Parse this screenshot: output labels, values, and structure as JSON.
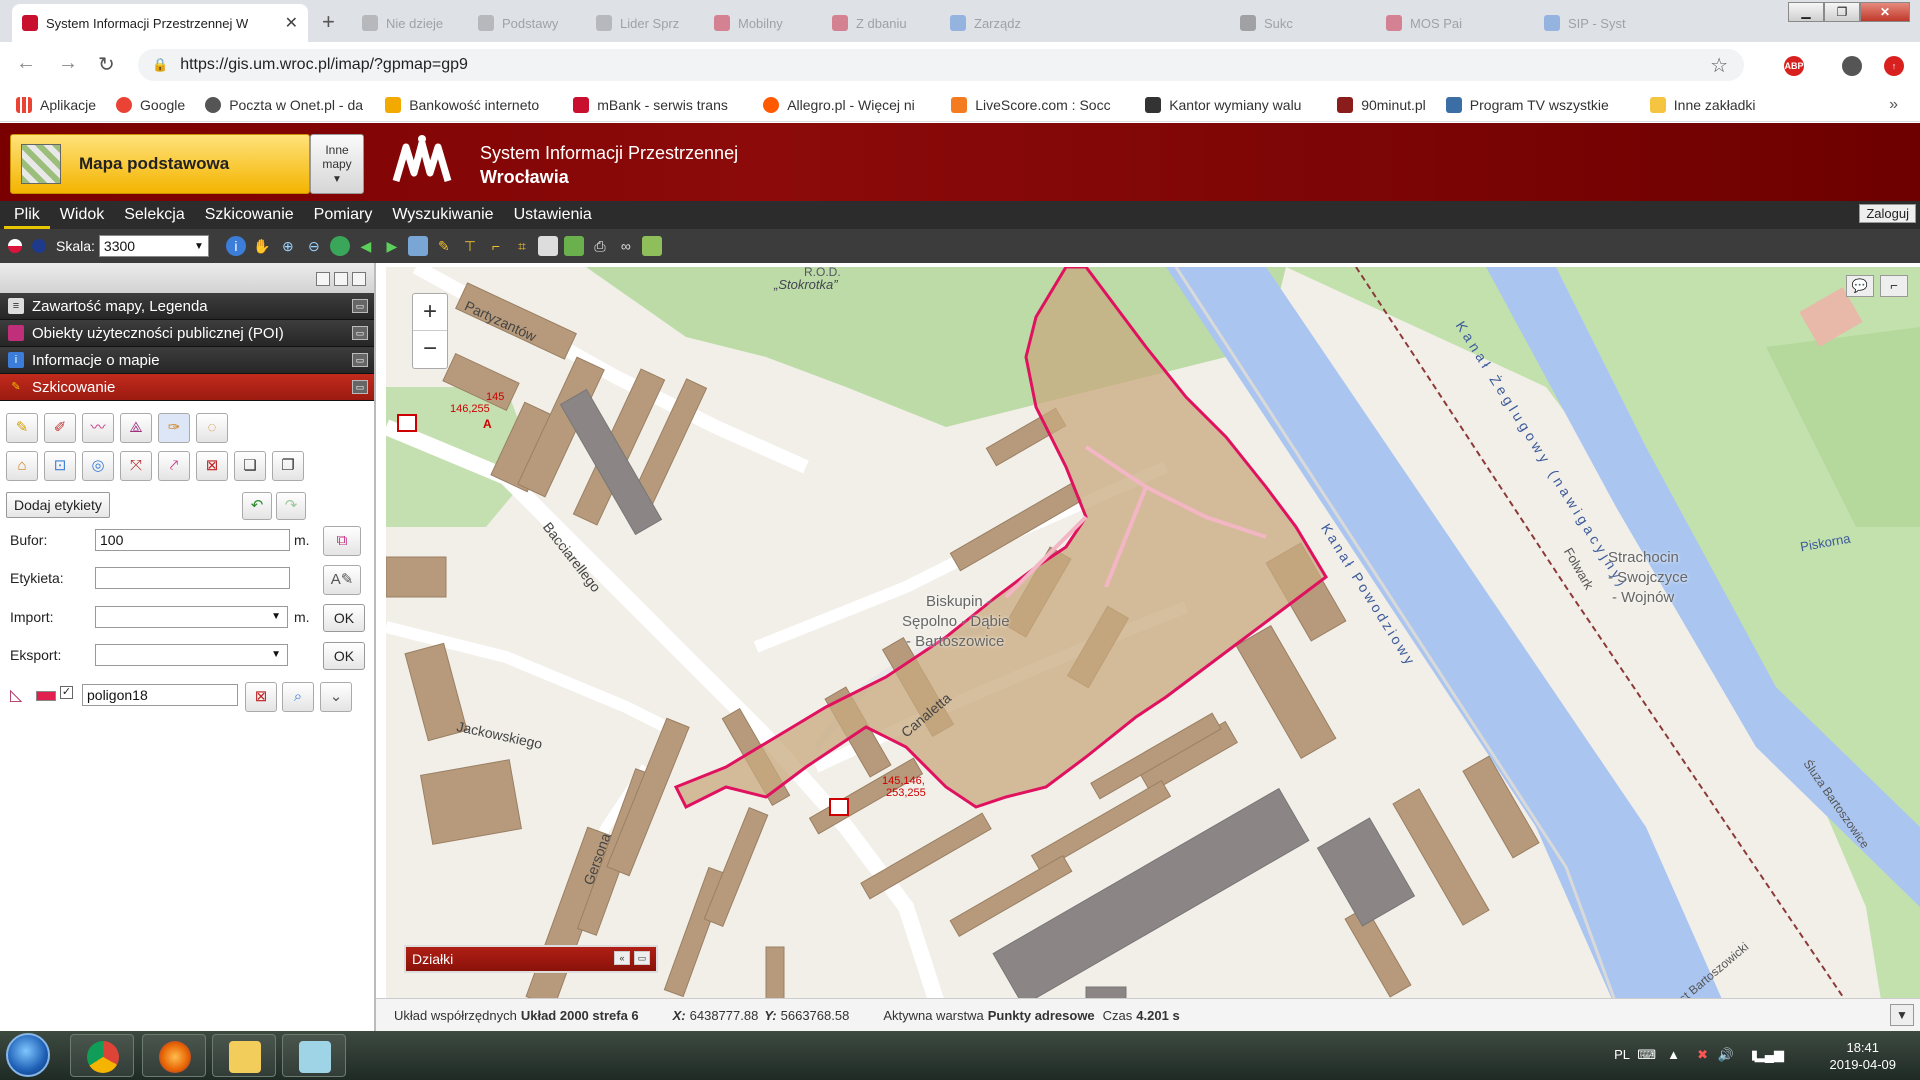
{
  "browser": {
    "tabs": [
      {
        "title": "System Informacji Przestrzennej W",
        "active": true
      },
      {
        "title": "Nie dzieje",
        "active": false
      },
      {
        "title": "Podstawy",
        "active": false
      },
      {
        "title": "Lider Sprz",
        "active": false
      },
      {
        "title": "Mobilny",
        "active": false
      },
      {
        "title": "Z dbaniu",
        "active": false
      },
      {
        "title": "Zarządz",
        "active": false
      },
      {
        "title": "Sukc",
        "active": false
      },
      {
        "title": "MOS Pai",
        "active": false
      },
      {
        "title": "SIP - Syst",
        "active": false
      }
    ],
    "close_glyph": "✕",
    "new_tab_glyph": "+",
    "url": "https://gis.um.wroc.pl/imap/?gpmap=gp9",
    "abp_label": "ABP",
    "bookmarks": [
      {
        "label": "Aplikacje",
        "color": "#4285f4"
      },
      {
        "label": "Google",
        "color": "#ea4335"
      },
      {
        "label": "Poczta w Onet.pl - da",
        "color": "#555555"
      },
      {
        "label": "Bankowość interneto",
        "color": "#f2a900"
      },
      {
        "label": "mBank - serwis trans",
        "color": "#c8102e"
      },
      {
        "label": "Allegro.pl - Więcej ni",
        "color": "#ff5a00"
      },
      {
        "label": "LiveScore.com : Socc",
        "color": "#f47b20"
      },
      {
        "label": "Kantor wymiany walu",
        "color": "#333333"
      },
      {
        "label": "90minut.pl",
        "color": "#8a1c1c"
      },
      {
        "label": "Program TV wszystkie",
        "color": "#3a6ea5"
      },
      {
        "label": "Inne zakładki",
        "color": "#f5c542"
      }
    ],
    "bookmarks_more": "»"
  },
  "app": {
    "map_button_label": "Mapa podstawowa",
    "other_maps_label_1": "Inne",
    "other_maps_label_2": "mapy",
    "title_line1": "System Informacji Przestrzennej",
    "title_line2": "Wrocławia",
    "menu": [
      "Plik",
      "Widok",
      "Selekcja",
      "Szkicowanie",
      "Pomiary",
      "Wyszukiwanie",
      "Ustawienia"
    ],
    "login_label": "Zaloguj",
    "scale_label": "Skala:",
    "scale_value": "3300"
  },
  "panel": {
    "sections": [
      {
        "label": "Zawartość mapy, Legenda",
        "icon_color": "#dddddd",
        "active": false
      },
      {
        "label": "Obiekty użyteczności publicznej (POI)",
        "icon_color": "#c0307a",
        "active": false
      },
      {
        "label": "Informacje o mapie",
        "icon_color": "#3b7dd8",
        "active": false
      },
      {
        "label": "Szkicowanie",
        "icon_color": "#f2c200",
        "active": true
      }
    ],
    "add_labels": "Dodaj etykiety",
    "buffer_label": "Bufor:",
    "buffer_value": "100",
    "buffer_unit": "m.",
    "label_label": "Etykieta:",
    "label_value": "",
    "import_label": "Import:",
    "import_unit": "m.",
    "export_label": "Eksport:",
    "ok_label": "OK",
    "polygon_name": "poligon18"
  },
  "map": {
    "zoom_in": "+",
    "zoom_out": "−",
    "labels": {
      "rod": "R.O.D.",
      "stokrotka": "„Stokrotka”",
      "partyzantow": "Partyzantów",
      "bacciarellego": "Bacciarellego",
      "jackowskiego": "Jackowskiego",
      "gersona": "Gersona",
      "canaletta": "Canaletta",
      "district_1": "Biskupin -",
      "district_2": "Sępolno - Dąbie",
      "district_3": "- Bartoszowice",
      "kanal_powodziowy": "Kanał Powodziowy",
      "kanal_zeglugowy": "Kanał Żeglugowy (nawigacyjny)",
      "folwark": "Folwark",
      "strachocin_1": "Strachocin",
      "strachocin_2": "- Swojczyce",
      "strachocin_3": "- Wojnów",
      "piskorna": "Piskorna",
      "sluza": "Śluza Bartoszowice",
      "mostbart": "Most Bartoszowicki",
      "addr1_a": "145",
      "addr1_b": "146,255",
      "addr2_a": "145,146,",
      "addr2_b": "253,255",
      "addr_marker": "A"
    },
    "dzialki_label": "Działki"
  },
  "status": {
    "coord_label": "Układ współrzędnych",
    "coord_value": "Układ 2000 strefa 6",
    "x_label": "X:",
    "x_value": "6438777.88",
    "y_label": "Y:",
    "y_value": "5663768.58",
    "layer_label": "Aktywna warstwa",
    "layer_value": "Punkty adresowe",
    "time_label": "Czas",
    "time_value": "4.201 s"
  },
  "taskbar": {
    "lang": "PL",
    "time": "18:41",
    "date": "2019-04-09"
  }
}
